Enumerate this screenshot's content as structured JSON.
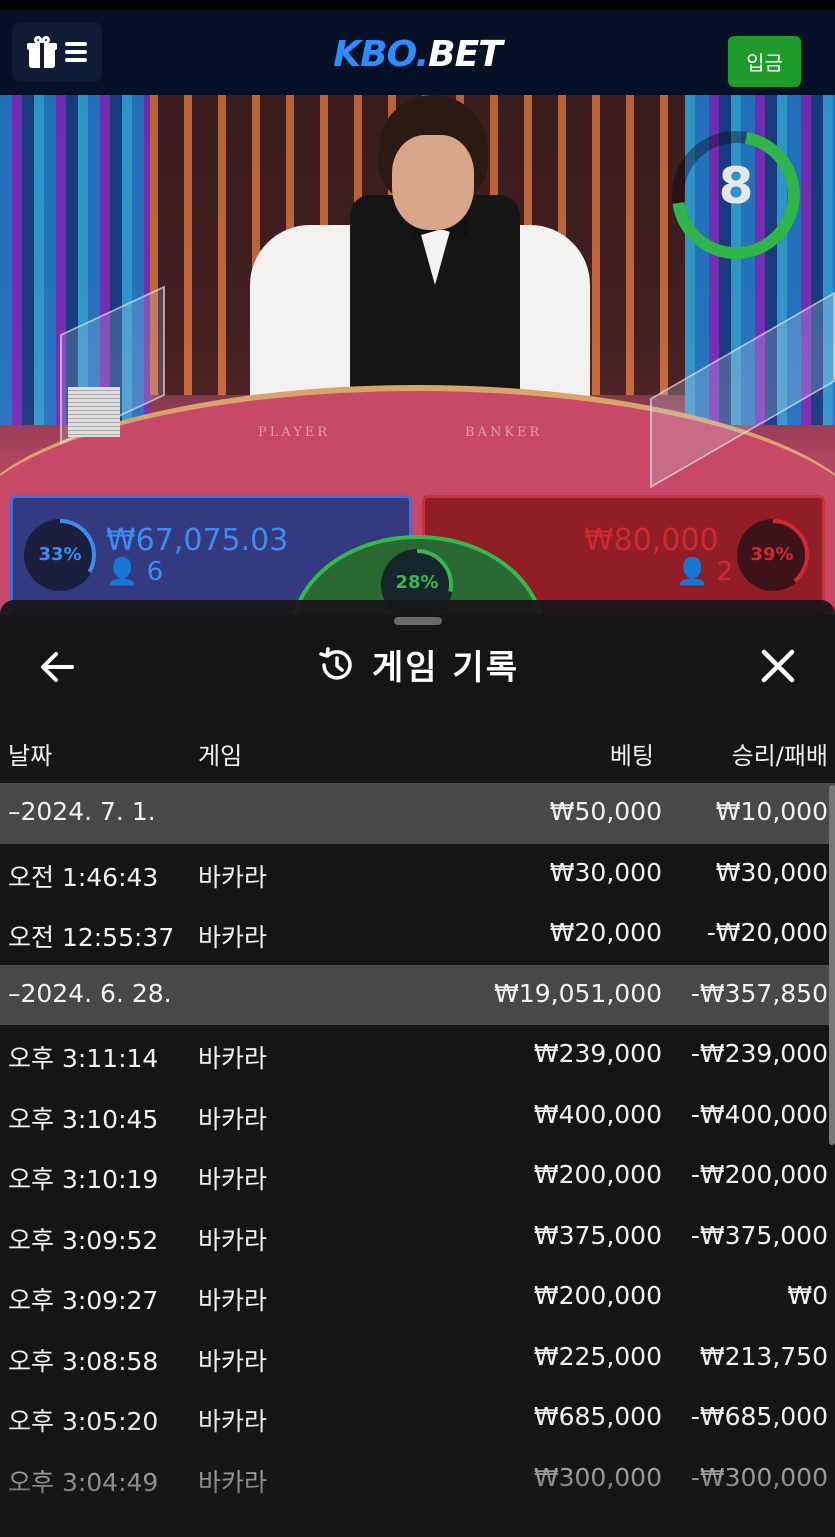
{
  "header": {
    "logo_main": "KBO",
    "logo_dot": ".",
    "logo_suffix": "BET",
    "deposit_label": "입금",
    "menu_icons": [
      "gift-icon",
      "hamburger-menu-icon"
    ]
  },
  "game": {
    "table_labels": {
      "player": "PLAYER",
      "banker": "BANKER"
    },
    "countdown": "8",
    "player": {
      "percent": "33%",
      "amount": "₩67,075.03",
      "count": "6"
    },
    "tie": {
      "percent": "28%"
    },
    "banker": {
      "percent": "39%",
      "amount": "₩80,000",
      "count": "2"
    },
    "colors": {
      "player": "#3d8cf0",
      "banker": "#d02a30",
      "tie": "#36b84a",
      "timer": "#2fb54a"
    }
  },
  "history": {
    "title": "게임 기록",
    "icons": [
      "back-arrow-icon",
      "history-clock-icon",
      "close-icon"
    ],
    "columns": {
      "date": "날짜",
      "game": "게임",
      "bet": "베팅",
      "result": "승리/패배"
    },
    "rows": [
      {
        "type": "group",
        "date": "–2024. 7. 1.",
        "game": "",
        "bet": "₩50,000",
        "result": "₩10,000"
      },
      {
        "type": "item",
        "date": "오전 1:46:43",
        "game": "바카라",
        "bet": "₩30,000",
        "result": "₩30,000"
      },
      {
        "type": "item",
        "date": "오전 12:55:37",
        "game": "바카라",
        "bet": "₩20,000",
        "result": "-₩20,000"
      },
      {
        "type": "group",
        "date": "–2024. 6. 28.",
        "game": "",
        "bet": "₩19,051,000",
        "result": "-₩357,850"
      },
      {
        "type": "item",
        "date": "오후 3:11:14",
        "game": "바카라",
        "bet": "₩239,000",
        "result": "-₩239,000"
      },
      {
        "type": "item",
        "date": "오후 3:10:45",
        "game": "바카라",
        "bet": "₩400,000",
        "result": "-₩400,000"
      },
      {
        "type": "item",
        "date": "오후 3:10:19",
        "game": "바카라",
        "bet": "₩200,000",
        "result": "-₩200,000"
      },
      {
        "type": "item",
        "date": "오후 3:09:52",
        "game": "바카라",
        "bet": "₩375,000",
        "result": "-₩375,000"
      },
      {
        "type": "item",
        "date": "오후 3:09:27",
        "game": "바카라",
        "bet": "₩200,000",
        "result": "₩0"
      },
      {
        "type": "item",
        "date": "오후 3:08:58",
        "game": "바카라",
        "bet": "₩225,000",
        "result": "₩213,750"
      },
      {
        "type": "item",
        "date": "오후 3:05:20",
        "game": "바카라",
        "bet": "₩685,000",
        "result": "-₩685,000"
      },
      {
        "type": "item",
        "date": "오후 3:04:49",
        "game": "바카라",
        "bet": "₩300,000",
        "result": "-₩300,000"
      }
    ]
  }
}
